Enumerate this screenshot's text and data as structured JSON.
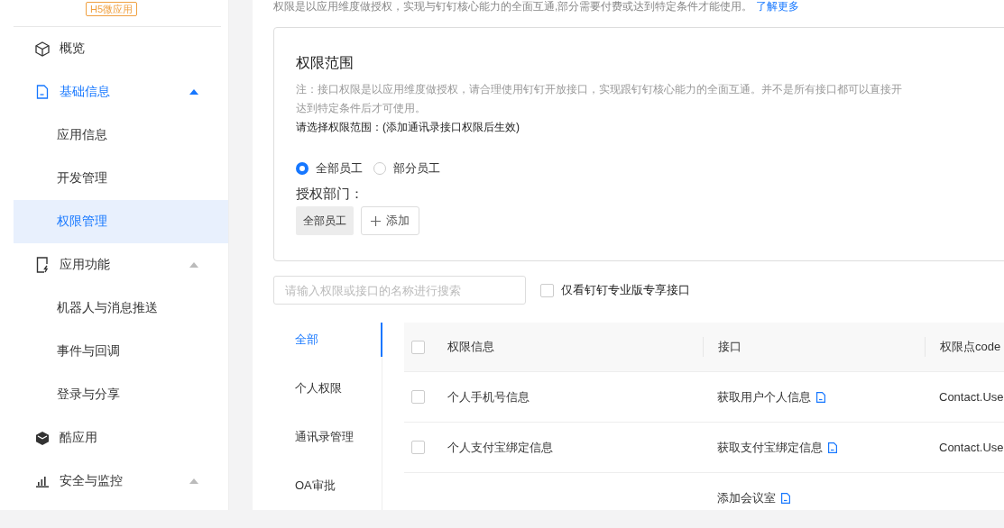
{
  "sidebar": {
    "badge": "H5微应用",
    "items": [
      {
        "label": "概览",
        "selected": false
      },
      {
        "label": "基础信息",
        "selected": false,
        "active": true,
        "expanded": true,
        "children": [
          {
            "label": "应用信息",
            "selected": false
          },
          {
            "label": "开发管理",
            "selected": false
          },
          {
            "label": "权限管理",
            "selected": true
          }
        ]
      },
      {
        "label": "应用功能",
        "selected": false,
        "active": false,
        "expanded": true,
        "children": [
          {
            "label": "机器人与消息推送",
            "selected": false
          },
          {
            "label": "事件与回调",
            "selected": false
          },
          {
            "label": "登录与分享",
            "selected": false
          }
        ]
      },
      {
        "label": "酷应用",
        "selected": false
      },
      {
        "label": "安全与监控",
        "selected": false,
        "active": false,
        "expanded": true
      }
    ]
  },
  "intro": {
    "text": "权限是以应用维度做授权，实现与钉钉核心能力的全面互通,部分需要付费或达到特定条件才能使用。",
    "link": "了解更多"
  },
  "scope_card": {
    "title": "权限范围",
    "note_lines": [
      "注：接口权限是以应用维度做授权，请合理使用钉钉开放接口，实现跟钉钉核心能力的全面互通。并不是所有接口都可以直接开",
      "达到特定条件后才可使用。"
    ],
    "prompt": "请选择权限范围：(添加通讯录接口权限后生效)",
    "radios": [
      {
        "label": "全部员工",
        "selected": true
      },
      {
        "label": "部分员工",
        "selected": false
      }
    ],
    "dept_label": "授权部门：",
    "dept_tags": [
      "全部员工"
    ],
    "add_button": "添加"
  },
  "search": {
    "placeholder": "请输入权限或接口的名称进行搜索"
  },
  "pro_filter": {
    "label": "仅看钉钉专业版专享接口",
    "checked": false
  },
  "categories": [
    {
      "label": "全部",
      "selected": true
    },
    {
      "label": "个人权限",
      "selected": false
    },
    {
      "label": "通讯录管理",
      "selected": false
    },
    {
      "label": "OA审批",
      "selected": false
    }
  ],
  "table": {
    "header_checked": false,
    "columns": [
      "权限信息",
      "接口",
      "权限点code"
    ],
    "rows": [
      {
        "checked": false,
        "permission": "个人手机号信息",
        "api": "获取用户个人信息",
        "code": "Contact.Use"
      },
      {
        "checked": false,
        "permission": "个人支付宝绑定信息",
        "api": "获取支付宝绑定信息",
        "code": "Contact.Use"
      },
      {
        "api": "添加会议室"
      }
    ]
  }
}
